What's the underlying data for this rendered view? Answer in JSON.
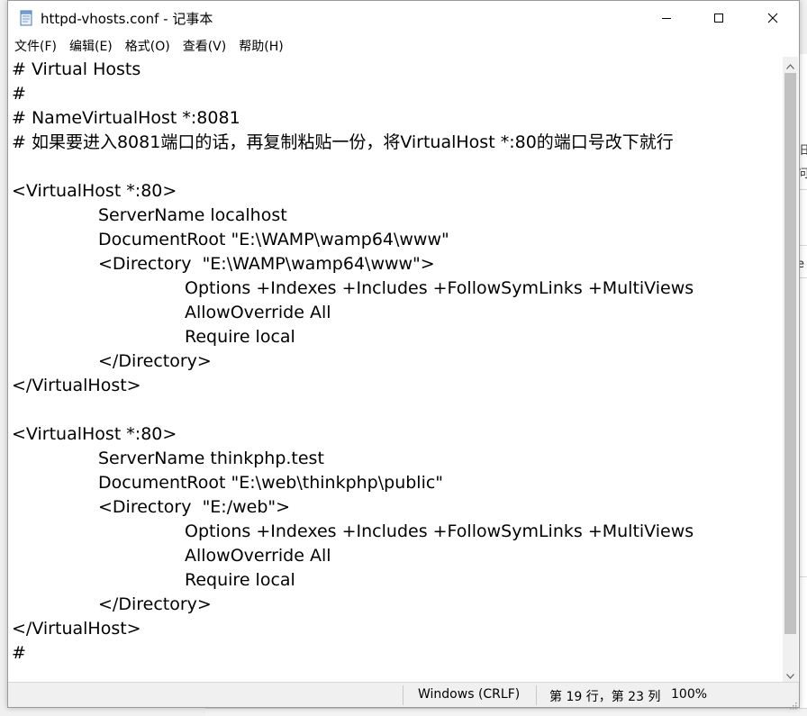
{
  "window": {
    "title": "httpd-vhosts.conf - 记事本",
    "app_icon": "notepad-icon",
    "minimize_icon": "minimize-icon",
    "maximize_icon": "maximize-icon",
    "close_icon": "close-icon"
  },
  "menu": {
    "items": [
      {
        "label": "文件(F)"
      },
      {
        "label": "编辑(E)"
      },
      {
        "label": "格式(O)"
      },
      {
        "label": "查看(V)"
      },
      {
        "label": "帮助(H)"
      }
    ]
  },
  "editor": {
    "lines": [
      "# Virtual Hosts",
      "#",
      "# NameVirtualHost *:8081",
      "# 如果要进入8081端口的话，再复制粘贴一份，将VirtualHost *:80的端口号改下就行",
      "",
      "<VirtualHost *:80>",
      "\t\tServerName localhost",
      "\t\tDocumentRoot \"E:\\WAMP\\wamp64\\www\"",
      "\t\t<Directory  \"E:\\WAMP\\wamp64\\www\">",
      "\t\t\t\tOptions +Indexes +Includes +FollowSymLinks +MultiViews",
      "\t\t\t\tAllowOverride All",
      "\t\t\t\tRequire local",
      "\t\t</Directory>",
      "</VirtualHost>",
      "",
      "<VirtualHost *:80>",
      "\t\tServerName thinkphp.test",
      "\t\tDocumentRoot \"E:\\web\\thinkphp\\public\"",
      "\t\t<Directory  \"E:/web\">",
      "\t\t\t\tOptions +Indexes +Includes +FollowSymLinks +MultiViews",
      "\t\t\t\tAllowOverride All",
      "\t\t\t\tRequire local",
      "\t\t</Directory>",
      "</VirtualHost>",
      "#"
    ]
  },
  "statusbar": {
    "line_ending": "Windows (CRLF)",
    "position": "第 19 行，第 23 列",
    "zoom": "100%"
  },
  "background": {
    "fragment_1": "旧",
    "fragment_2": "问",
    "fragment_3": "e"
  }
}
